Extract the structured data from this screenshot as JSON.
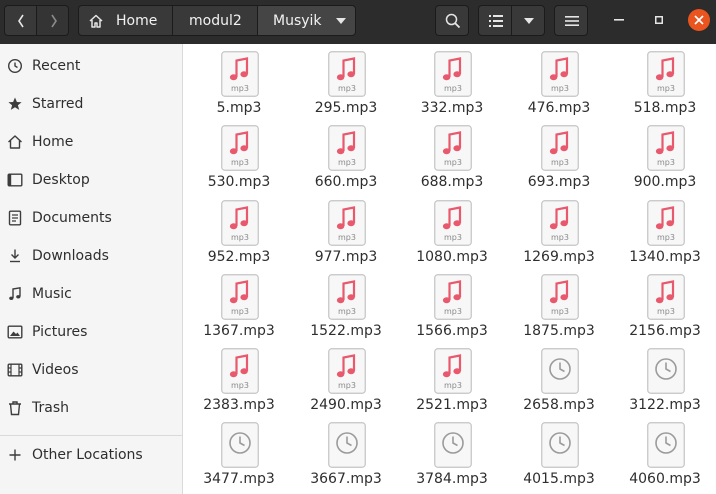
{
  "window": {
    "breadcrumb": [
      "Home",
      "modul2",
      "Musyik"
    ]
  },
  "sidebar": {
    "items": [
      {
        "label": "Recent",
        "icon": "clock-icon"
      },
      {
        "label": "Starred",
        "icon": "star-icon"
      },
      {
        "label": "Home",
        "icon": "home-icon"
      },
      {
        "label": "Desktop",
        "icon": "desktop-icon"
      },
      {
        "label": "Documents",
        "icon": "document-icon"
      },
      {
        "label": "Downloads",
        "icon": "download-icon"
      },
      {
        "label": "Music",
        "icon": "music-icon"
      },
      {
        "label": "Pictures",
        "icon": "picture-icon"
      },
      {
        "label": "Videos",
        "icon": "video-icon"
      },
      {
        "label": "Trash",
        "icon": "trash-icon"
      },
      {
        "label": "Other Locations",
        "icon": "plus-icon"
      }
    ]
  },
  "files": [
    {
      "name": "5.mp3",
      "kind": "mp3"
    },
    {
      "name": "295.mp3",
      "kind": "mp3"
    },
    {
      "name": "332.mp3",
      "kind": "mp3"
    },
    {
      "name": "476.mp3",
      "kind": "mp3"
    },
    {
      "name": "518.mp3",
      "kind": "mp3"
    },
    {
      "name": "530.mp3",
      "kind": "mp3"
    },
    {
      "name": "660.mp3",
      "kind": "mp3"
    },
    {
      "name": "688.mp3",
      "kind": "mp3"
    },
    {
      "name": "693.mp3",
      "kind": "mp3"
    },
    {
      "name": "900.mp3",
      "kind": "mp3"
    },
    {
      "name": "952.mp3",
      "kind": "mp3"
    },
    {
      "name": "977.mp3",
      "kind": "mp3"
    },
    {
      "name": "1080.mp3",
      "kind": "mp3"
    },
    {
      "name": "1269.mp3",
      "kind": "mp3"
    },
    {
      "name": "1340.mp3",
      "kind": "mp3"
    },
    {
      "name": "1367.mp3",
      "kind": "mp3"
    },
    {
      "name": "1522.mp3",
      "kind": "mp3"
    },
    {
      "name": "1566.mp3",
      "kind": "mp3"
    },
    {
      "name": "1875.mp3",
      "kind": "mp3"
    },
    {
      "name": "2156.mp3",
      "kind": "mp3"
    },
    {
      "name": "2383.mp3",
      "kind": "mp3"
    },
    {
      "name": "2490.mp3",
      "kind": "mp3"
    },
    {
      "name": "2521.mp3",
      "kind": "mp3"
    },
    {
      "name": "2658.mp3",
      "kind": "pending"
    },
    {
      "name": "3122.mp3",
      "kind": "pending"
    },
    {
      "name": "3477.mp3",
      "kind": "pending"
    },
    {
      "name": "3667.mp3",
      "kind": "pending"
    },
    {
      "name": "3784.mp3",
      "kind": "pending"
    },
    {
      "name": "4015.mp3",
      "kind": "pending"
    },
    {
      "name": "4060.mp3",
      "kind": "pending"
    }
  ],
  "icons": {
    "mp3_badge": "mp3",
    "mp3_color": "#e8596d",
    "pending_color": "#9b9b9b",
    "close_color": "#e9541f"
  }
}
